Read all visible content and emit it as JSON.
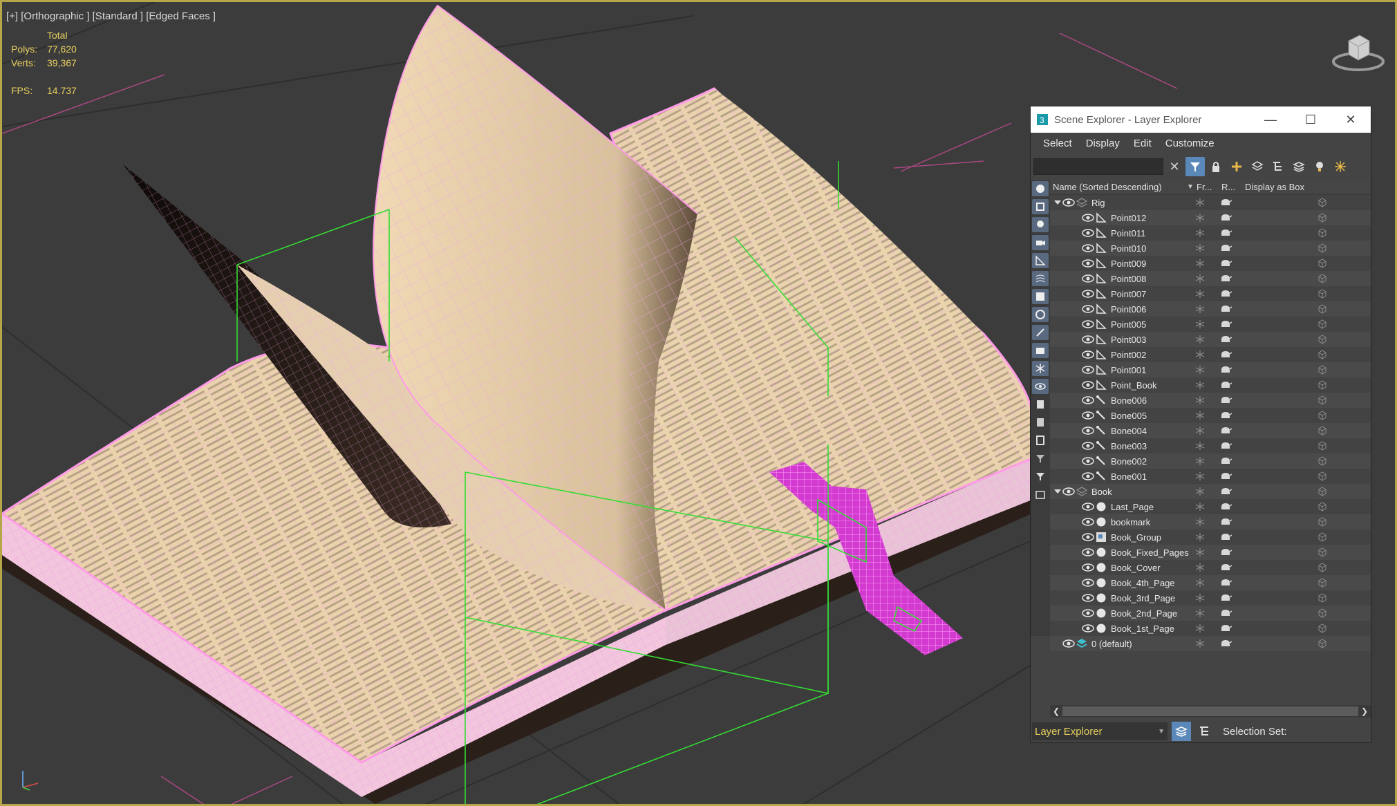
{
  "viewport": {
    "label": "[+] [Orthographic ] [Standard ] [Edged Faces ]",
    "stats": {
      "total_label": "Total",
      "polys_label": "Polys:",
      "polys_value": "77,620",
      "verts_label": "Verts:",
      "verts_value": "39,367",
      "fps_label": "FPS:",
      "fps_value": "14.737"
    }
  },
  "explorer": {
    "title": "Scene Explorer - Layer Explorer",
    "menu": [
      "Select",
      "Display",
      "Edit",
      "Customize"
    ],
    "search_value": "",
    "columns": {
      "name": "Name (Sorted Descending)",
      "freeze": "Fr...",
      "render": "R...",
      "display_as_box": "Display as Box"
    },
    "rows": [
      {
        "label": "Rig",
        "level": 0,
        "type": "layer",
        "expanded": true
      },
      {
        "label": "Point012",
        "level": 1,
        "type": "point"
      },
      {
        "label": "Point011",
        "level": 1,
        "type": "point"
      },
      {
        "label": "Point010",
        "level": 1,
        "type": "point"
      },
      {
        "label": "Point009",
        "level": 1,
        "type": "point"
      },
      {
        "label": "Point008",
        "level": 1,
        "type": "point"
      },
      {
        "label": "Point007",
        "level": 1,
        "type": "point"
      },
      {
        "label": "Point006",
        "level": 1,
        "type": "point"
      },
      {
        "label": "Point005",
        "level": 1,
        "type": "point"
      },
      {
        "label": "Point003",
        "level": 1,
        "type": "point"
      },
      {
        "label": "Point002",
        "level": 1,
        "type": "point"
      },
      {
        "label": "Point001",
        "level": 1,
        "type": "point"
      },
      {
        "label": "Point_Book",
        "level": 1,
        "type": "point"
      },
      {
        "label": "Bone006",
        "level": 1,
        "type": "bone"
      },
      {
        "label": "Bone005",
        "level": 1,
        "type": "bone"
      },
      {
        "label": "Bone004",
        "level": 1,
        "type": "bone"
      },
      {
        "label": "Bone003",
        "level": 1,
        "type": "bone"
      },
      {
        "label": "Bone002",
        "level": 1,
        "type": "bone"
      },
      {
        "label": "Bone001",
        "level": 1,
        "type": "bone"
      },
      {
        "label": "Book",
        "level": 0,
        "type": "layer",
        "expanded": true
      },
      {
        "label": "Last_Page",
        "level": 1,
        "type": "geometry"
      },
      {
        "label": "bookmark",
        "level": 1,
        "type": "geometry"
      },
      {
        "label": "Book_Group",
        "level": 1,
        "type": "group"
      },
      {
        "label": "Book_Fixed_Pages",
        "level": 1,
        "type": "geometry"
      },
      {
        "label": "Book_Cover",
        "level": 1,
        "type": "geometry"
      },
      {
        "label": "Book_4th_Page",
        "level": 1,
        "type": "geometry"
      },
      {
        "label": "Book_3rd_Page",
        "level": 1,
        "type": "geometry"
      },
      {
        "label": "Book_2nd_Page",
        "level": 1,
        "type": "geometry"
      },
      {
        "label": "Book_1st_Page",
        "level": 1,
        "type": "geometry"
      },
      {
        "label": "0 (default)",
        "level": 0,
        "type": "default-layer",
        "expanded": false
      }
    ],
    "explorer_select_value": "Layer Explorer",
    "selection_set_label": "Selection Set:"
  },
  "colors": {
    "viewport_bg": "#3c3c3c",
    "stats_text": "#e8d060",
    "wire_pink": "#ff9be8",
    "bookmark": "#d23ad0",
    "helper_green": "#33dd33",
    "accent_blue": "#5a88b8"
  }
}
